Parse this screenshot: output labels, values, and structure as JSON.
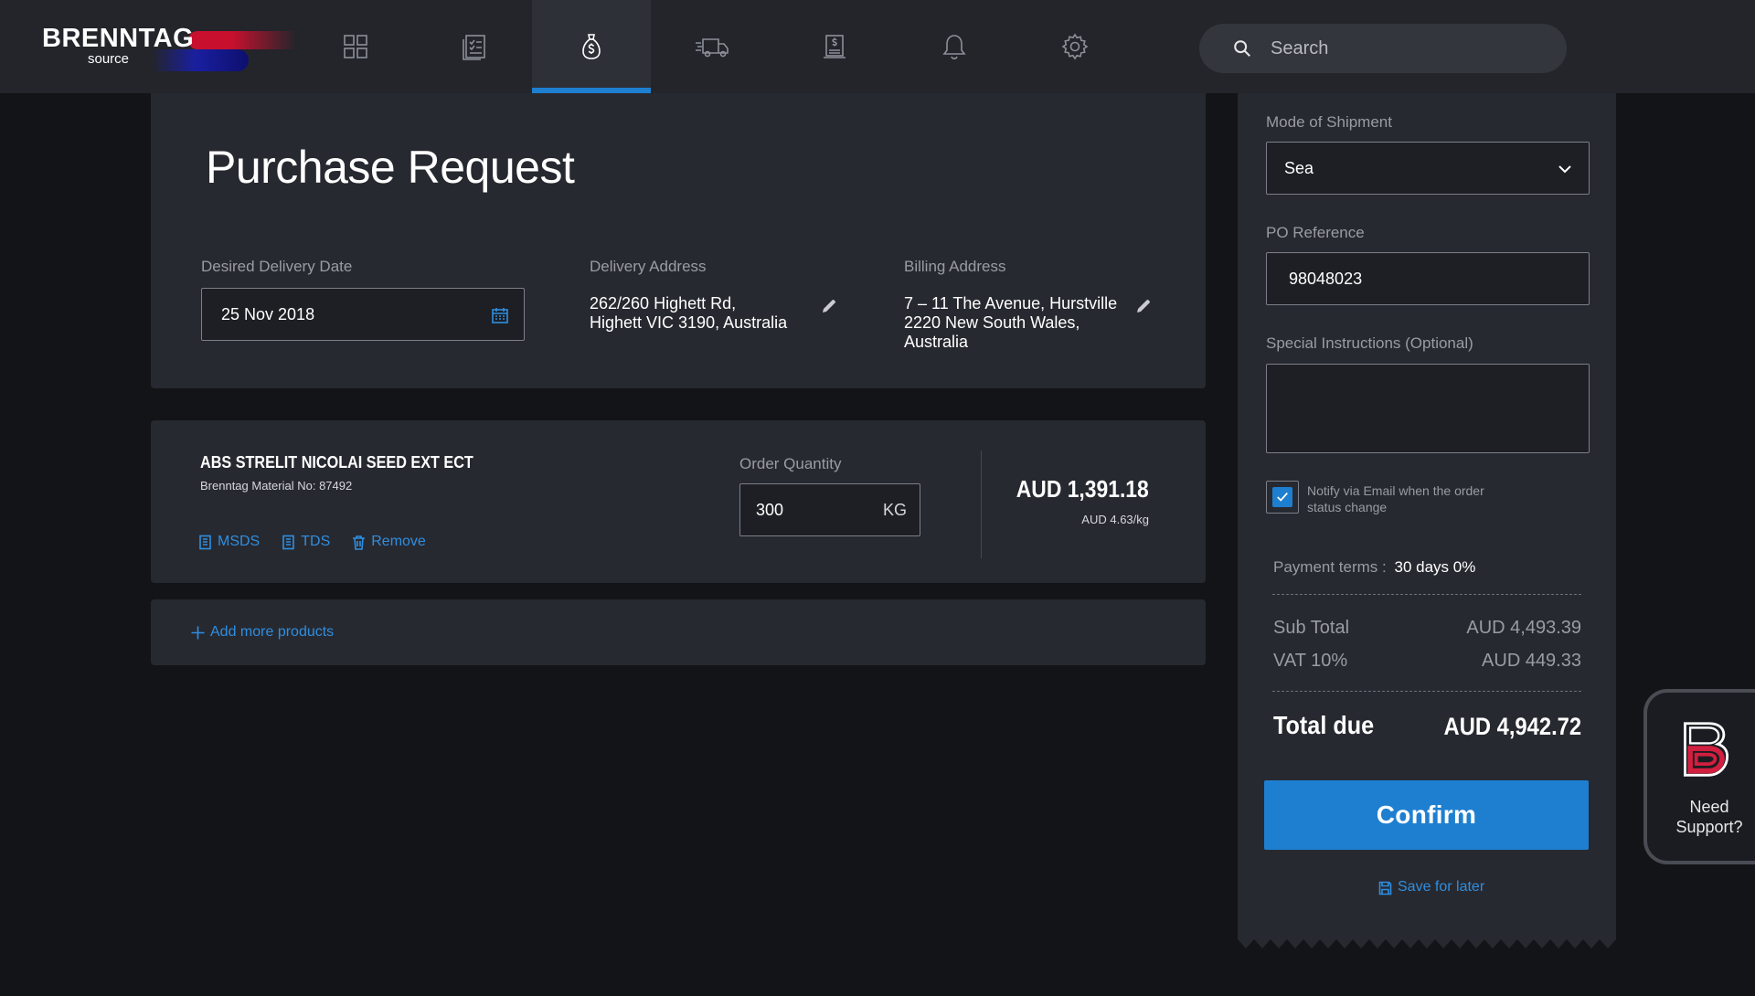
{
  "brand": {
    "name": "BRENNTAG",
    "sub": "source"
  },
  "nav": {
    "items": [
      {
        "name": "dashboard-icon"
      },
      {
        "name": "orders-checklist-icon"
      },
      {
        "name": "purchase-tag-icon",
        "active": true
      },
      {
        "name": "delivery-truck-icon"
      },
      {
        "name": "invoice-icon"
      },
      {
        "name": "bell-icon"
      },
      {
        "name": "gear-icon"
      }
    ]
  },
  "search": {
    "placeholder": "Search"
  },
  "purchase": {
    "title": "Purchase Request",
    "delivery_date_label": "Desired Delivery Date",
    "delivery_date_value": "25 Nov 2018",
    "delivery_address_label": "Delivery Address",
    "delivery_address_line1": "262/260 Highett Rd,",
    "delivery_address_line2": "Highett VIC 3190, Australia",
    "billing_address_label": "Billing Address",
    "billing_address_line1": "7 – 11 The Avenue, Hurstville",
    "billing_address_line2": "2220 New South Wales,",
    "billing_address_line3": "Australia"
  },
  "product": {
    "name": "ABS STRELIT NICOLAI SEED EXT ECT",
    "material_label": "Brenntag Material No:",
    "material_no": "87492",
    "links": {
      "msds": "MSDS",
      "tds": "TDS",
      "remove": "Remove"
    },
    "quantity_label": "Order Quantity",
    "quantity_value": "300",
    "quantity_unit": "KG",
    "price": "AUD 1,391.18",
    "unit_price": "AUD 4.63/kg"
  },
  "add_more": {
    "label": "Add more products"
  },
  "sidebar": {
    "shipment_label": "Mode of Shipment",
    "shipment_value": "Sea",
    "po_label": "PO Reference",
    "po_value": "98048023",
    "instructions_label": "Special Instructions (Optional)",
    "instructions_value": "",
    "notify_label_line1": "Notify via Email when the order",
    "notify_label_line2": "status change",
    "notify_checked": true,
    "payment_terms_label": "Payment terms :",
    "payment_terms_value": "30 days 0%",
    "subtotal_label": "Sub Total",
    "subtotal_value": "AUD 4,493.39",
    "vat_label": "VAT 10%",
    "vat_value": "AUD 449.33",
    "total_label": "Total due",
    "total_value": "AUD 4,942.72",
    "confirm_label": "Confirm",
    "save_label": "Save for later"
  },
  "support": {
    "line1": "Need",
    "line2": "Support?"
  },
  "colors": {
    "accent": "#1e7fd0",
    "brand_red": "#c8102e",
    "brand_blue": "#1a1fa0",
    "background": "#131417",
    "card": "#272930"
  }
}
